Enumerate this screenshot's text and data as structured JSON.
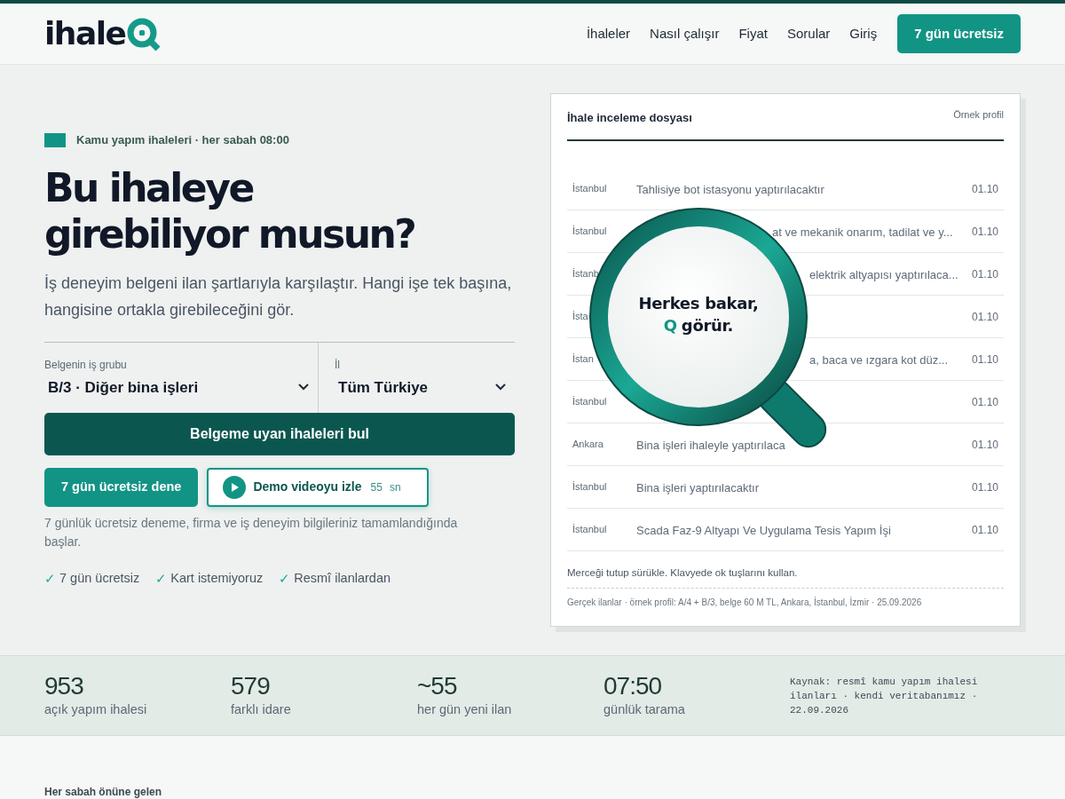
{
  "header": {
    "brand": "ihale",
    "nav": [
      "İhaleler",
      "Nasıl çalışır",
      "Fiyat",
      "Sorular",
      "Giriş"
    ],
    "cta": "7 gün ücretsiz"
  },
  "hero": {
    "eyebrow": "Kamu yapım ihaleleri · her sabah 08:00",
    "title_lines": [
      "Bu ihaleye",
      "girebiliyor musun?"
    ],
    "lead": "İş deneyim belgeni ilan şartlarıyla karşılaştır. Hangi işe tek başına, hangisine ortakla girebileceğini gör.",
    "selects": [
      {
        "label": "Belgenin iş grubu",
        "value": "B/3 · Diğer bina işleri"
      },
      {
        "label": "İl",
        "value": "Tüm Türkiye"
      }
    ],
    "search_button": "Belgeme uyan ihaleleri bul",
    "trial_button": "7 gün ücretsiz dene",
    "demo": {
      "label": "Demo videoyu izle",
      "duration": "55",
      "unit": "sn"
    },
    "note": "7 günlük ücretsiz deneme, firma ve iş deneyim bilgileriniz tamamlandığında başlar.",
    "ticks": [
      {
        "mark": "✓",
        "text": "7 gün ücretsiz"
      },
      {
        "mark": "✓",
        "text": "Kart istemiyoruz"
      },
      {
        "mark": "✓",
        "text": "Resmî ilanlardan"
      }
    ]
  },
  "card": {
    "title": "İhale inceleme dosyası",
    "badge": "Örnek profil",
    "rows": [
      {
        "city": "İstanbul",
        "title": "Tahlisiye bot istasyonu yaptırılacaktır",
        "date": "01.10",
        "kind": "open"
      },
      {
        "city": "İstanbul",
        "title": "at ve mekanik onarım, tadilat ve y...",
        "date": "01.10",
        "kind": "rim"
      },
      {
        "city": "İstanb",
        "title": "elektrik altyapısı yaptırılaca...",
        "date": "01.10",
        "kind": "lens"
      },
      {
        "city": "İsta",
        "date": "01.10",
        "kind": "hidden"
      },
      {
        "city": "İstan",
        "title": "a, baca ve ızgara kot düz...",
        "date": "01.10",
        "kind": "lens"
      },
      {
        "city": "İstanbul",
        "date": "01.10",
        "kind": "hidden"
      },
      {
        "city": "Ankara",
        "title": "Bina işleri ihaleyle yaptırılaca",
        "date": "01.10",
        "kind": "open"
      },
      {
        "city": "İstanbul",
        "title": "Bina işleri yaptırılacaktır",
        "date": "01.10",
        "kind": "open"
      },
      {
        "city": "İstanbul",
        "title": "Scada Faz-9 Altyapı Ve Uygulama Tesis Yapım İşi",
        "date": "01.10",
        "kind": "open"
      }
    ],
    "hint": "Merceği tutup sürükle. Klavyede ok tuşlarını kullan.",
    "footer": "Gerçek ilanlar · örnek profil: A/4 + B/3, belge 60 M TL, Ankara, İstanbul, İzmir · 25.09.2026",
    "lens": {
      "line1": "Herkes bakar,",
      "mark": "Q",
      "line2": "görür."
    }
  },
  "stats": [
    {
      "value": "953",
      "label": "açık yapım ihalesi"
    },
    {
      "value": "579",
      "label": "farklı idare"
    },
    {
      "value": "~55",
      "label": "her gün yeni ilan"
    },
    {
      "value": "07:50",
      "label": "günlük tarama"
    }
  ],
  "source": "Kaynak: resmî kamu yapım ihalesi ilanları · kendi veritabanımız · 22.09.2026",
  "next_section": {
    "eyebrow": "Her sabah önüne gelen"
  }
}
